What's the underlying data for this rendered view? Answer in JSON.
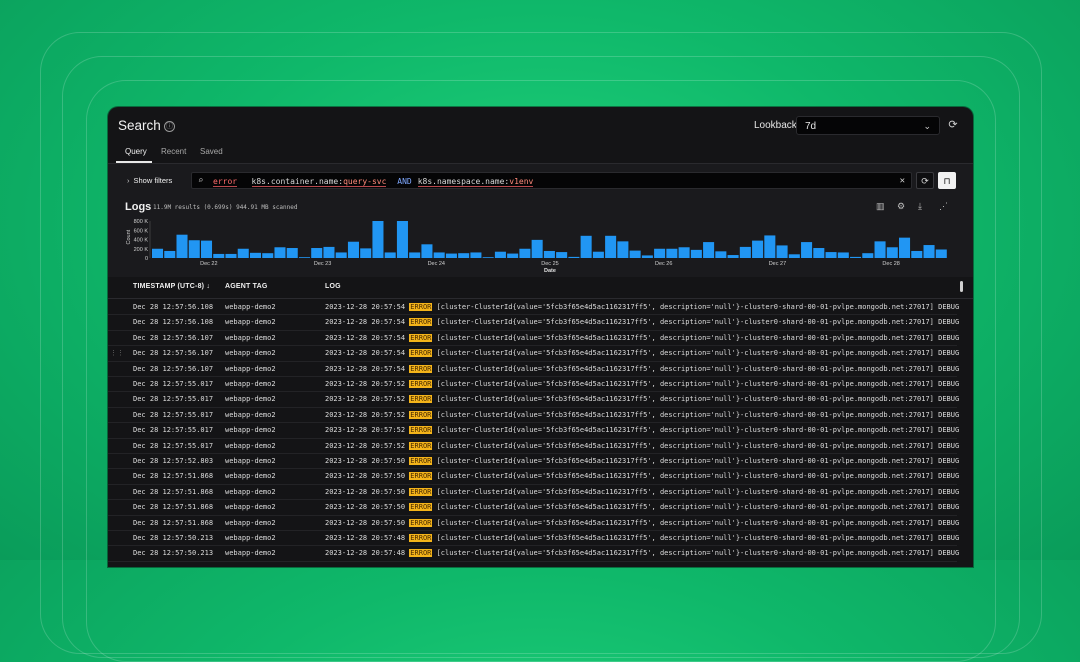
{
  "header": {
    "title": "Search",
    "lookback_label": "Lookback:",
    "lookback_value": "7d"
  },
  "tabs": [
    "Query",
    "Recent",
    "Saved"
  ],
  "filters": {
    "show_filters_label": "Show filters",
    "query": {
      "term": "error",
      "key1": "k8s.container.name",
      "val1": "query-svc",
      "op": "AND",
      "key2": "k8s.namespace.name",
      "val2": "v1env"
    }
  },
  "logs": {
    "title": "Logs",
    "meta": "11.9M results (0.699s) 944.91 MB scanned"
  },
  "chart_data": {
    "type": "bar",
    "xlabel": "Date",
    "ylabel": "Count",
    "ylim": [
      0,
      1000
    ],
    "yticks": [
      "800 K",
      "600 K",
      "400 K",
      "200 K",
      "0"
    ],
    "xticks": [
      "Dec 22",
      "Dec 23",
      "Dec 24",
      "Dec 25",
      "Dec 26",
      "Dec 27",
      "Dec 28"
    ],
    "values": [
      250,
      190,
      630,
      480,
      470,
      110,
      110,
      250,
      140,
      130,
      290,
      270,
      10,
      270,
      300,
      150,
      440,
      260,
      1000,
      150,
      1000,
      150,
      370,
      150,
      120,
      130,
      150,
      20,
      170,
      120,
      250,
      490,
      190,
      160,
      30,
      600,
      170,
      600,
      450,
      200,
      70,
      250,
      250,
      290,
      220,
      430,
      180,
      80,
      300,
      470,
      610,
      340,
      100,
      430,
      270,
      160,
      150,
      30,
      130,
      450,
      290,
      550,
      190,
      350,
      230
    ]
  },
  "table": {
    "columns": [
      "TIMESTAMP (UTC-8)",
      "AGENT TAG",
      "LOG"
    ],
    "sort_indicator": "↓",
    "rows": [
      {
        "ts": "Dec 28 12:57:56.108",
        "tag": "webapp-demo2",
        "time": "2023-12-28 20:57:54",
        "level": "ERROR",
        "msg": "[cluster-ClusterId{value='5fcb3f65e4d5ac1162317ff5', description='null'}-cluster0-shard-00-01-pvlpe.mongodb.net:27017] DEBUG"
      },
      {
        "ts": "Dec 28 12:57:56.108",
        "tag": "webapp-demo2",
        "time": "2023-12-28 20:57:54",
        "level": "ERROR",
        "msg": "[cluster-ClusterId{value='5fcb3f65e4d5ac1162317ff5', description='null'}-cluster0-shard-00-01-pvlpe.mongodb.net:27017] DEBUG"
      },
      {
        "ts": "Dec 28 12:57:56.107",
        "tag": "webapp-demo2",
        "time": "2023-12-28 20:57:54",
        "level": "ERROR",
        "msg": "[cluster-ClusterId{value='5fcb3f65e4d5ac1162317ff5', description='null'}-cluster0-shard-00-01-pvlpe.mongodb.net:27017] DEBUG"
      },
      {
        "ts": "Dec 28 12:57:56.107",
        "tag": "webapp-demo2",
        "time": "2023-12-28 20:57:54",
        "level": "ERROR",
        "msg": "[cluster-ClusterId{value='5fcb3f65e4d5ac1162317ff5', description='null'}-cluster0-shard-00-01-pvlpe.mongodb.net:27017] DEBUG"
      },
      {
        "ts": "Dec 28 12:57:56.107",
        "tag": "webapp-demo2",
        "time": "2023-12-28 20:57:54",
        "level": "ERROR",
        "msg": "[cluster-ClusterId{value='5fcb3f65e4d5ac1162317ff5', description='null'}-cluster0-shard-00-01-pvlpe.mongodb.net:27017] DEBUG"
      },
      {
        "ts": "Dec 28 12:57:55.017",
        "tag": "webapp-demo2",
        "time": "2023-12-28 20:57:52",
        "level": "ERROR",
        "msg": "[cluster-ClusterId{value='5fcb3f65e4d5ac1162317ff5', description='null'}-cluster0-shard-00-01-pvlpe.mongodb.net:27017] DEBUG"
      },
      {
        "ts": "Dec 28 12:57:55.017",
        "tag": "webapp-demo2",
        "time": "2023-12-28 20:57:52",
        "level": "ERROR",
        "msg": "[cluster-ClusterId{value='5fcb3f65e4d5ac1162317ff5', description='null'}-cluster0-shard-00-01-pvlpe.mongodb.net:27017] DEBUG"
      },
      {
        "ts": "Dec 28 12:57:55.017",
        "tag": "webapp-demo2",
        "time": "2023-12-28 20:57:52",
        "level": "ERROR",
        "msg": "[cluster-ClusterId{value='5fcb3f65e4d5ac1162317ff5', description='null'}-cluster0-shard-00-01-pvlpe.mongodb.net:27017] DEBUG"
      },
      {
        "ts": "Dec 28 12:57:55.017",
        "tag": "webapp-demo2",
        "time": "2023-12-28 20:57:52",
        "level": "ERROR",
        "msg": "[cluster-ClusterId{value='5fcb3f65e4d5ac1162317ff5', description='null'}-cluster0-shard-00-01-pvlpe.mongodb.net:27017] DEBUG"
      },
      {
        "ts": "Dec 28 12:57:55.017",
        "tag": "webapp-demo2",
        "time": "2023-12-28 20:57:52",
        "level": "ERROR",
        "msg": "[cluster-ClusterId{value='5fcb3f65e4d5ac1162317ff5', description='null'}-cluster0-shard-00-01-pvlpe.mongodb.net:27017] DEBUG"
      },
      {
        "ts": "Dec 28 12:57:52.803",
        "tag": "webapp-demo2",
        "time": "2023-12-28 20:57:50",
        "level": "ERROR",
        "msg": "[cluster-ClusterId{value='5fcb3f65e4d5ac1162317ff5', description='null'}-cluster0-shard-00-01-pvlpe.mongodb.net:27017] DEBUG"
      },
      {
        "ts": "Dec 28 12:57:51.868",
        "tag": "webapp-demo2",
        "time": "2023-12-28 20:57:50",
        "level": "ERROR",
        "msg": "[cluster-ClusterId{value='5fcb3f65e4d5ac1162317ff5', description='null'}-cluster0-shard-00-01-pvlpe.mongodb.net:27017] DEBUG"
      },
      {
        "ts": "Dec 28 12:57:51.868",
        "tag": "webapp-demo2",
        "time": "2023-12-28 20:57:50",
        "level": "ERROR",
        "msg": "[cluster-ClusterId{value='5fcb3f65e4d5ac1162317ff5', description='null'}-cluster0-shard-00-01-pvlpe.mongodb.net:27017] DEBUG"
      },
      {
        "ts": "Dec 28 12:57:51.868",
        "tag": "webapp-demo2",
        "time": "2023-12-28 20:57:50",
        "level": "ERROR",
        "msg": "[cluster-ClusterId{value='5fcb3f65e4d5ac1162317ff5', description='null'}-cluster0-shard-00-01-pvlpe.mongodb.net:27017] DEBUG"
      },
      {
        "ts": "Dec 28 12:57:51.868",
        "tag": "webapp-demo2",
        "time": "2023-12-28 20:57:50",
        "level": "ERROR",
        "msg": "[cluster-ClusterId{value='5fcb3f65e4d5ac1162317ff5', description='null'}-cluster0-shard-00-01-pvlpe.mongodb.net:27017] DEBUG"
      },
      {
        "ts": "Dec 28 12:57:50.213",
        "tag": "webapp-demo2",
        "time": "2023-12-28 20:57:48",
        "level": "ERROR",
        "msg": "[cluster-ClusterId{value='5fcb3f65e4d5ac1162317ff5', description='null'}-cluster0-shard-00-01-pvlpe.mongodb.net:27017] DEBUG"
      },
      {
        "ts": "Dec 28 12:57:50.213",
        "tag": "webapp-demo2",
        "time": "2023-12-28 20:57:48",
        "level": "ERROR",
        "msg": "[cluster-ClusterId{value='5fcb3f65e4d5ac1162317ff5', description='null'}-cluster0-shard-00-01-pvlpe.mongodb.net:27017] DEBUG"
      }
    ]
  },
  "icons": {
    "info": "ⓘ",
    "chevron_down": "⌄",
    "refresh": "⟳",
    "chevron_right": "›",
    "search": "⌕",
    "clear": "✕",
    "bookmark": "⊓",
    "bar_chart": "▥",
    "settings": "⚙",
    "download": "⤓",
    "share": "⋰",
    "drag": "⋮⋮"
  },
  "colors": {
    "bar": "#2196f3",
    "error_badge": "#f4b41a",
    "panel": "#141416"
  }
}
